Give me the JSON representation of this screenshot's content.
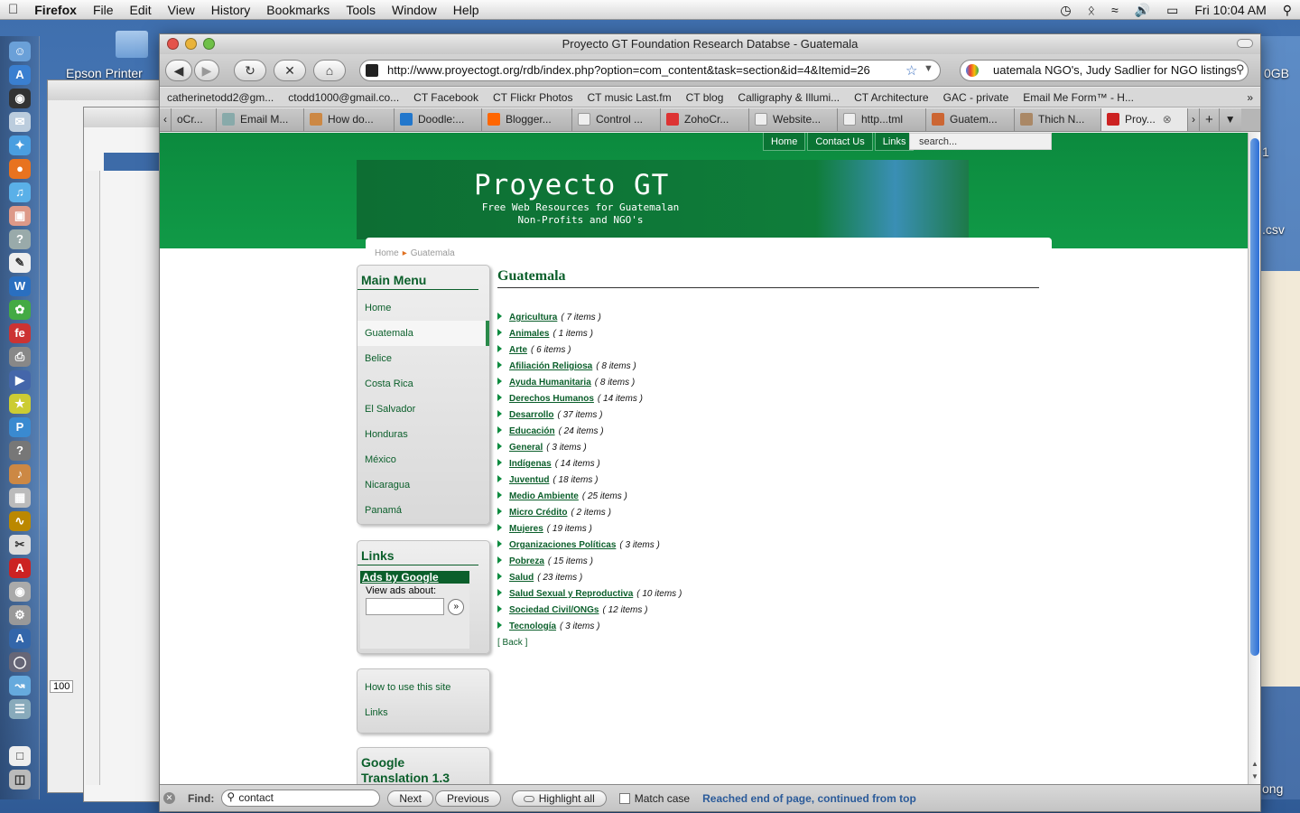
{
  "menubar": {
    "app": "Firefox",
    "items": [
      "File",
      "Edit",
      "View",
      "History",
      "Bookmarks",
      "Tools",
      "Window",
      "Help"
    ],
    "clock": "Fri 10:04 AM"
  },
  "desktop": {
    "icon_label": "Epson Printer",
    "right_labels": [
      "0GB",
      "1",
      ".csv",
      "ong"
    ],
    "ruler_value": "100"
  },
  "window": {
    "title": "Proyecto GT Foundation Research Databse - Guatemala",
    "url": "http://www.proyectogt.org/rdb/index.php?option=com_content&task=section&id=4&Itemid=26",
    "search_value": "uatemala NGO's, Judy Sadlier for NGO listings"
  },
  "bookmarks": [
    "catherinetodd2@gm...",
    "ctodd1000@gmail.co...",
    "CT Facebook",
    "CT Flickr Photos",
    "CT music Last.fm",
    "CT blog",
    "Calligraphy & Illumi...",
    "CT Architecture",
    "GAC - private",
    "Email Me Form™ - H..."
  ],
  "tabs": [
    {
      "label": "oCr...",
      "color": "#999"
    },
    {
      "label": "Email M...",
      "color": "#8aa"
    },
    {
      "label": "How do...",
      "color": "#c84"
    },
    {
      "label": "Doodle:...",
      "color": "#27c"
    },
    {
      "label": "Blogger...",
      "color": "#f60"
    },
    {
      "label": "Control ...",
      "color": "#ddd"
    },
    {
      "label": "ZohoCr...",
      "color": "#d33"
    },
    {
      "label": "Website...",
      "color": "#ddd"
    },
    {
      "label": "http...tml",
      "color": "#ddd"
    },
    {
      "label": "Guatem...",
      "color": "#c63"
    },
    {
      "label": "Thich N...",
      "color": "#a86"
    },
    {
      "label": "Proy...",
      "color": "#c22"
    }
  ],
  "site": {
    "topnav": [
      "Home",
      "Contact Us",
      "Links"
    ],
    "search_placeholder": "search...",
    "banner_title": "Proyecto GT",
    "banner_sub1": "Free Web Resources for Guatemalan",
    "banner_sub2": "Non-Profits and NGO's",
    "breadcrumb": [
      "Home",
      "Guatemala"
    ],
    "main_menu_title": "Main Menu",
    "main_menu": [
      "Home",
      "Guatemala",
      "Belice",
      "Costa Rica",
      "El Salvador",
      "Honduras",
      "México",
      "Nicaragua",
      "Panamá"
    ],
    "links_title": "Links",
    "ads_label": "Ads by Google",
    "view_ads": "View ads about:",
    "extra_menu": [
      "How to use this site",
      "Links"
    ],
    "translation_title": "Google Translation 1.3",
    "section_title": "Guatemala",
    "categories": [
      {
        "name": "Agricultura",
        "count": "( 7 items )"
      },
      {
        "name": "Animales",
        "count": "( 1 items )"
      },
      {
        "name": "Arte",
        "count": "( 6 items )"
      },
      {
        "name": "Afiliación Religiosa",
        "count": "( 8 items )"
      },
      {
        "name": "Ayuda Humanitaria",
        "count": "( 8 items )"
      },
      {
        "name": "Derechos Humanos",
        "count": "( 14 items )"
      },
      {
        "name": "Desarrollo",
        "count": "( 37 items )"
      },
      {
        "name": "Educación",
        "count": "( 24 items )"
      },
      {
        "name": "General",
        "count": "( 3 items )"
      },
      {
        "name": "Indígenas",
        "count": "( 14 items )"
      },
      {
        "name": "Juventud",
        "count": "( 18 items )"
      },
      {
        "name": "Medio Ambiente",
        "count": "( 25 items )"
      },
      {
        "name": "Micro Crédito",
        "count": "( 2 items )"
      },
      {
        "name": "Mujeres",
        "count": "( 19 items )"
      },
      {
        "name": "Organizaciones Políticas",
        "count": "( 3 items )"
      },
      {
        "name": "Pobreza",
        "count": "( 15 items )"
      },
      {
        "name": "Salud",
        "count": "( 23 items )"
      },
      {
        "name": "Salud Sexual y Reproductiva",
        "count": "( 10 items )"
      },
      {
        "name": "Sociedad Civil/ONGs",
        "count": "( 12 items )"
      },
      {
        "name": "Tecnología",
        "count": "( 3 items )"
      }
    ],
    "back_label": "[ Back ]"
  },
  "findbar": {
    "label": "Find:",
    "value": "contact",
    "next": "Next",
    "previous": "Previous",
    "highlight": "Highlight all",
    "match_case": "Match case",
    "status": "Reached end of page, continued from top"
  },
  "colors": {
    "site_green": "#0c8a3e",
    "link_green": "#0b5f2b",
    "status_blue": "#2b5b9a"
  }
}
